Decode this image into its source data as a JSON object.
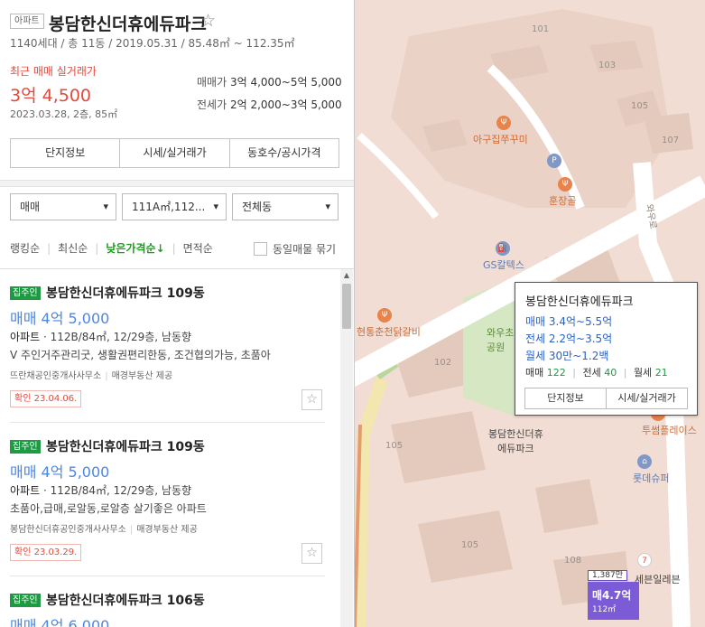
{
  "complex": {
    "type_badge": "아파트",
    "name": "봉담한신더휴에듀파크",
    "favorite_glyph": "☆",
    "info": "1140세대 / 총 11동 / 2019.05.31 / 85.48㎡ ~ 112.35㎡",
    "recent_label": "최근 매매 실거래가",
    "recent_price": "3억 4,500",
    "recent_date": "2023.03.28, 2층, 85㎡",
    "sale_label": "매매가",
    "sale_range": "3억 4,000~5억 5,000",
    "jeonse_label": "전세가",
    "jeonse_range": "2억 2,000~3억 5,000"
  },
  "tabs": [
    "단지정보",
    "시세/실거래가",
    "동호수/공시가격"
  ],
  "filters": {
    "trade_type": "매매",
    "area": "111A㎡,112...",
    "dong": "전체동"
  },
  "sort": {
    "options": [
      "랭킹순",
      "최신순",
      "낮은가격순↓",
      "면적순"
    ],
    "same_listing_label": "동일매물 묶기"
  },
  "listings": [
    {
      "badge": "집주인",
      "title": "봉담한신더휴에듀파크 109동",
      "price": "매매 4억 5,000",
      "spec_type": "아파트",
      "spec": " · 112B/84㎡, 12/29층, 남동향",
      "desc": "V 주인거주관리굿, 생활권편리한동, 조건협의가능, 초품아",
      "agent": "뜨란채공인중개사사무소",
      "provider": "매경부동산 제공",
      "confirm": "확인 23.04.06.",
      "fav": "☆"
    },
    {
      "badge": "집주인",
      "title": "봉담한신더휴에듀파크 109동",
      "price": "매매 4억 5,000",
      "spec_type": "아파트",
      "spec": " · 112B/84㎡, 12/29층, 남동향",
      "desc": "초품아,급매,로알동,로알층 살기좋은 아파트",
      "agent": "봉담한신더휴공인중개사사무소",
      "provider": "매경부동산 제공",
      "confirm": "확인 23.03.29.",
      "fav": "☆"
    },
    {
      "badge": "집주인",
      "title": "봉담한신더휴에듀파크 106동",
      "price": "매매 4억 6,000"
    }
  ],
  "scroll_up": "▲",
  "map": {
    "building_numbers": [
      "101",
      "103",
      "105",
      "107",
      "102",
      "105",
      "105",
      "108"
    ],
    "pois": {
      "restaurant1": "아구집쭈꾸미",
      "restaurant2": "훈장골",
      "gas": "GS칼텍스",
      "bbq": "현통춘천닭갈비",
      "school": "와우초\n공원",
      "road": "와우로",
      "tourist": "투썸플레이스",
      "market": "롯데슈퍼",
      "convenience": "세븐일레븐",
      "complex_label": "봉담한신더휴\n에듀파크"
    },
    "popup": {
      "title": "봉담한신더휴에듀파크",
      "sale": "매매 3.4억~5.5억",
      "jeonse": "전세 2.2억~3.5억",
      "monthly": "월세 30만~1.2백",
      "count_sale_label": "매매",
      "count_sale": "122",
      "count_jeonse_label": "전세",
      "count_jeonse": "40",
      "count_monthly_label": "월세",
      "count_monthly": "21",
      "btn_info": "단지정보",
      "btn_price": "시세/실거래가"
    },
    "marker": {
      "top": "1,387만",
      "price": "매4.7억",
      "area": "112㎡"
    },
    "poi_icons": {
      "restaurant": "fork-knife-icon",
      "parking": "P",
      "gas": "fuel-icon"
    },
    "colors": {
      "road": "#ffffff",
      "background": "#f1ddd3",
      "park": "#d6e7c4",
      "marker": "#7b5cd6",
      "brand_green": "#1e9a43",
      "price_red": "#e5483b",
      "price_blue": "#4a86e8"
    }
  }
}
